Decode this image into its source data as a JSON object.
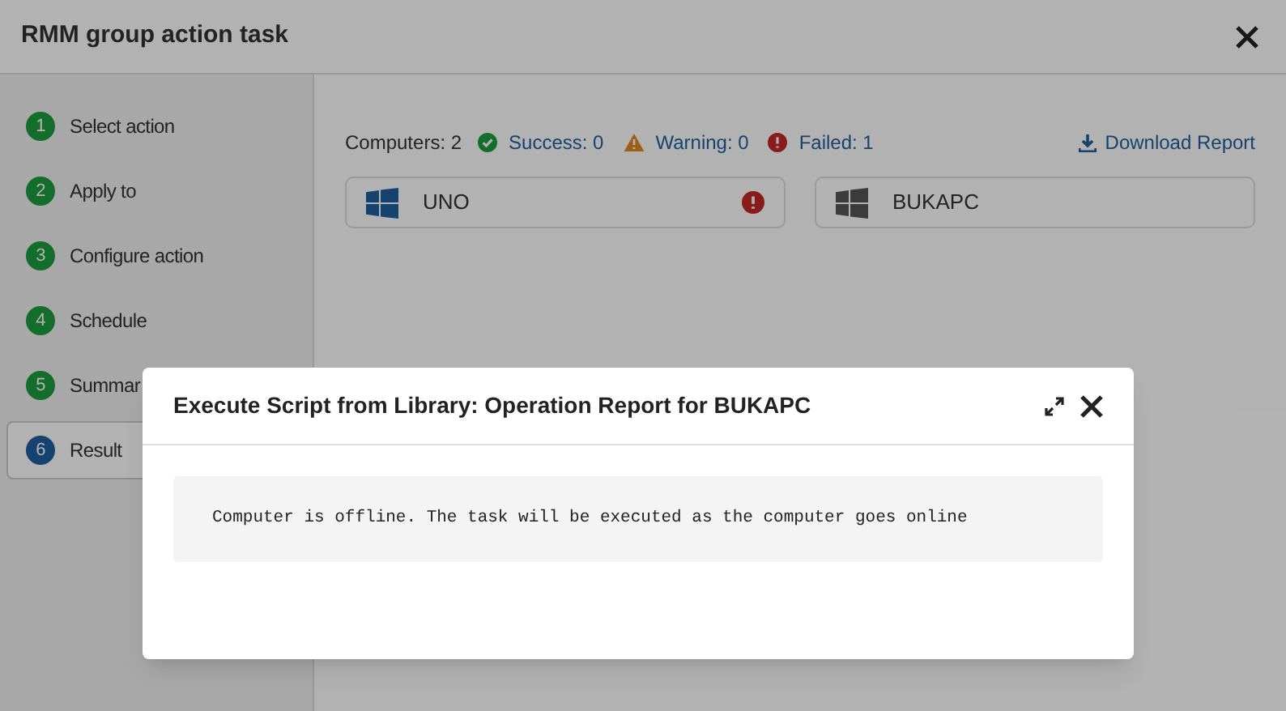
{
  "window": {
    "title": "RMM group action task"
  },
  "steps": [
    {
      "number": "1",
      "label": "Select action",
      "done": true,
      "selected": false
    },
    {
      "number": "2",
      "label": "Apply to",
      "done": true,
      "selected": false
    },
    {
      "number": "3",
      "label": "Configure action",
      "done": true,
      "selected": false
    },
    {
      "number": "4",
      "label": "Schedule",
      "done": true,
      "selected": false
    },
    {
      "number": "5",
      "label": "Summar",
      "done": true,
      "selected": false
    },
    {
      "number": "6",
      "label": "Result",
      "done": false,
      "selected": true
    }
  ],
  "summary": {
    "computers": "Computers: 2",
    "counts": [
      {
        "kind": "success",
        "label": "Success: 0"
      },
      {
        "kind": "warning",
        "label": "Warning: 0"
      },
      {
        "kind": "failed",
        "label": "Failed: 1"
      }
    ],
    "download": "Download Report"
  },
  "computers": [
    {
      "name": "UNO",
      "online": true,
      "failed": true
    },
    {
      "name": "BUKAPC",
      "online": false,
      "failed": false
    }
  ],
  "dialog": {
    "title": "Execute Script from Library: Operation Report for BUKAPC",
    "message": "Computer is offline. The task will be executed as the computer goes online"
  }
}
